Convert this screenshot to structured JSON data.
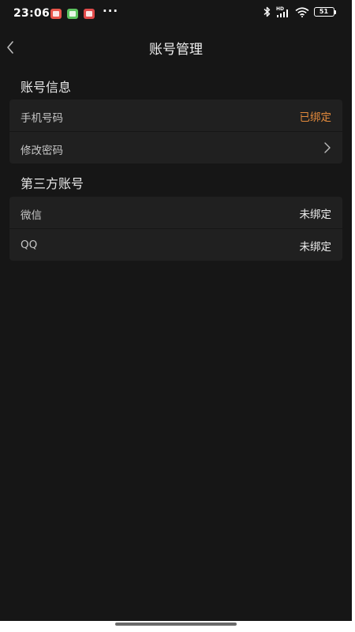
{
  "status_bar": {
    "time": "23:06",
    "more": "···",
    "battery": "51",
    "icons": [
      "notification-app-icon",
      "download-app-icon",
      "shopping-app-icon",
      "bluetooth-icon",
      "hd-signal-icon",
      "wifi-icon",
      "battery-icon"
    ]
  },
  "nav": {
    "title": "账号管理",
    "back_icon": "chevron-left-icon"
  },
  "account_info": {
    "header": "账号信息",
    "rows": [
      {
        "label": "手机号码",
        "value": "已绑定",
        "value_color": "#e38a3c"
      },
      {
        "label": "修改密码",
        "icon": "chevron-right-icon"
      }
    ]
  },
  "third_party": {
    "header": "第三方账号",
    "rows": [
      {
        "label": "微信",
        "value": "未绑定"
      },
      {
        "label": "QQ",
        "value": "未绑定"
      }
    ]
  },
  "colors": {
    "background": "#161616",
    "card": "#202020",
    "accent": "#e38a3c"
  }
}
